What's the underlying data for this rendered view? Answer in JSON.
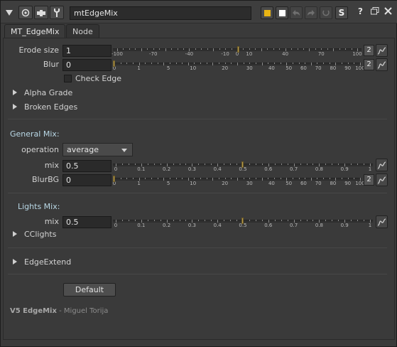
{
  "titlebar": {
    "node_name": "mtEdgeMix",
    "s_label": "S",
    "help": "?",
    "icons": [
      "collapse-triangle-icon",
      "view-node-icon",
      "center-node-icon",
      "wrench-icon",
      "undo-icon",
      "redo-icon",
      "revert-icon",
      "float-panel-icon",
      "close-icon"
    ],
    "colors": {
      "node_color": "#e8b414",
      "font_color": "#ffffff"
    }
  },
  "tabs": [
    {
      "label": "MT_EdgeMix",
      "active": true
    },
    {
      "label": "Node",
      "active": false
    }
  ],
  "erode": {
    "label": "Erode size",
    "value": "1",
    "ticks": [
      "-100",
      "-70",
      "-40",
      "-10",
      "0",
      "10",
      "40",
      "70",
      "100"
    ],
    "button": "2"
  },
  "blur": {
    "label": "Blur",
    "value": "0",
    "ticks": [
      "0",
      "1",
      "5",
      "10",
      "20",
      "30",
      "40",
      "50",
      "60",
      "70",
      "80",
      "90",
      "100"
    ],
    "button": "2"
  },
  "check_edge": {
    "label": "Check Edge",
    "checked": false
  },
  "groups": {
    "alpha_grade": "Alpha Grade",
    "broken_edges": "Broken Edges",
    "cclights": "CClights",
    "edge_extend": "EdgeExtend"
  },
  "general_mix": {
    "title": "General Mix:",
    "operation_label": "operation",
    "operation_value": "average",
    "mix_label": "mix",
    "mix_value": "0.5",
    "mix_ticks": [
      "0",
      "0.1",
      "0.2",
      "0.3",
      "0.4",
      "0.5",
      "0.6",
      "0.7",
      "0.8",
      "0.9",
      "1"
    ],
    "blurbg_label": "BlurBG",
    "blurbg_value": "0",
    "blurbg_ticks": [
      "0",
      "1",
      "5",
      "10",
      "20",
      "30",
      "40",
      "50",
      "60",
      "70",
      "80",
      "90",
      "100"
    ],
    "blurbg_button": "2"
  },
  "lights_mix": {
    "title": "Lights Mix:",
    "mix_label": "mix",
    "mix_value": "0.5",
    "mix_ticks": [
      "0",
      "0.1",
      "0.2",
      "0.3",
      "0.4",
      "0.5",
      "0.6",
      "0.7",
      "0.8",
      "0.9",
      "1"
    ]
  },
  "default_button": "Default",
  "credit": {
    "title": "V5 EdgeMix",
    "separator": " - ",
    "author": "Miguel Torija"
  }
}
